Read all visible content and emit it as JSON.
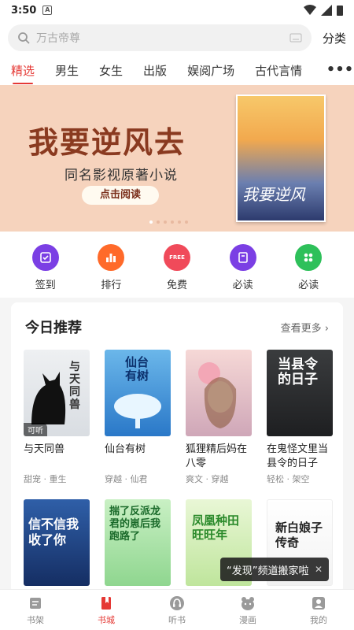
{
  "status_bar": {
    "time": "3:50",
    "notif_letter": "A"
  },
  "search": {
    "placeholder": "万古帝尊",
    "category_label": "分类"
  },
  "tabs": [
    {
      "label": "精选",
      "active": true
    },
    {
      "label": "男生"
    },
    {
      "label": "女生"
    },
    {
      "label": "出版"
    },
    {
      "label": "娱阅广场"
    },
    {
      "label": "古代言情"
    }
  ],
  "tabs_more": "•••",
  "banner": {
    "title": "我要逆风去",
    "subtitle": "同名影视原著小说",
    "cta": "点击阅读",
    "cover_text": "我要逆风"
  },
  "quick_links": [
    {
      "label": "签到",
      "icon": "checkin-icon",
      "color": "#7b3fe4",
      "glyph": "✓"
    },
    {
      "label": "排行",
      "icon": "ranking-icon",
      "color": "#ff6a2a",
      "glyph": "▮▮"
    },
    {
      "label": "免费",
      "icon": "free-icon",
      "color": "#f04a5a",
      "glyph": "FREE"
    },
    {
      "label": "必读",
      "icon": "must-read-icon",
      "color": "#7b3fe4",
      "glyph": "▣"
    },
    {
      "label": "必读",
      "icon": "grid-icon",
      "color": "#2ec05a",
      "glyph": "⁘"
    }
  ],
  "recommend": {
    "title": "今日推荐",
    "more": "查看更多 ›",
    "row1": [
      {
        "title": "与天同兽",
        "meta": "甜宠 · 重生",
        "badge": "可听",
        "cover_text": "与天同兽",
        "c1": "#eef0f2",
        "c2": "#d9dde2",
        "tc": "#333"
      },
      {
        "title": "仙台有树",
        "meta": "穿越 · 仙君",
        "cover_text": "仙台有树",
        "c1": "#6bb7ea",
        "c2": "#2a78c8",
        "tc": "#0b2f6b"
      },
      {
        "title": "狐狸精后妈在八零",
        "meta": "爽文 · 穿越",
        "cover_text": "",
        "c1": "#f6d8d6",
        "c2": "#cfa7b8",
        "tc": "#fff"
      },
      {
        "title": "在鬼怪文里当县令的日子",
        "meta": "轻松 · 架空",
        "cover_text": "当县令的日子",
        "c1": "#3a3c3e",
        "c2": "#1e1f21",
        "tc": "#fff"
      }
    ],
    "row2": [
      {
        "cover_text": "信不信我收了你",
        "c1": "#2f5fa8",
        "c2": "#152e63",
        "tc": "#fff"
      },
      {
        "cover_text": "揣了反派龙君的崽后我跑路了",
        "c1": "#c9f0c4",
        "c2": "#8fd68f",
        "tc": "#1a6a2a"
      },
      {
        "cover_text": "凤凰种田旺旺年",
        "c1": "#e9f7d6",
        "c2": "#bfe59c",
        "tc": "#2b8a2b"
      },
      {
        "cover_text": "新白娘子传奇",
        "c1": "#ffffff",
        "c2": "#f2f2f2",
        "tc": "#222"
      }
    ]
  },
  "toast": {
    "text": "“发现”频道搬家啦",
    "close": "✕"
  },
  "bottom_nav": [
    {
      "label": "书架",
      "icon": "bookshelf-icon"
    },
    {
      "label": "书城",
      "icon": "bookstore-icon",
      "active": true
    },
    {
      "label": "听书",
      "icon": "audiobook-icon"
    },
    {
      "label": "漫画",
      "icon": "comic-icon"
    },
    {
      "label": "我的",
      "icon": "profile-icon"
    }
  ]
}
